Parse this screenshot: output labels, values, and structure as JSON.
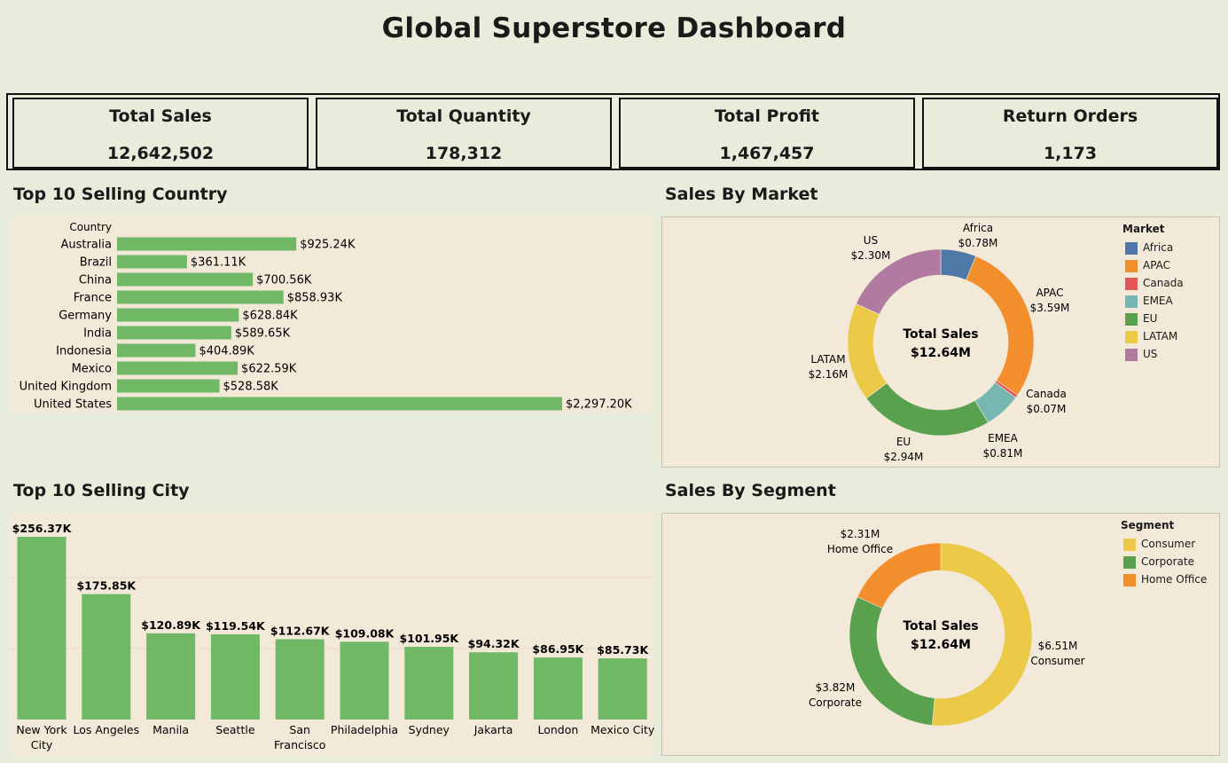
{
  "dashboard": {
    "title": "Global Superstore Dashboard"
  },
  "kpis": [
    {
      "label": "Total Sales",
      "value": "12,642,502"
    },
    {
      "label": "Total Quantity",
      "value": "178,312"
    },
    {
      "label": "Total Profit",
      "value": "1,467,457"
    },
    {
      "label": "Return Orders",
      "value": "1,173"
    }
  ],
  "sections": {
    "country": "Top 10 Selling Country",
    "market": "Sales By Market",
    "city": "Top 10 Selling City",
    "segment": "Sales By Segment"
  },
  "chart_data": [
    {
      "id": "country",
      "type": "bar",
      "orientation": "horizontal",
      "title": "Top 10 Selling Country",
      "axis_header": "Country",
      "color": "#70b865",
      "categories": [
        "Australia",
        "Brazil",
        "China",
        "France",
        "Germany",
        "India",
        "Indonesia",
        "Mexico",
        "United Kingdom",
        "United States"
      ],
      "values": [
        925.24,
        361.11,
        700.56,
        858.93,
        628.84,
        589.65,
        404.89,
        622.59,
        528.58,
        2297.2
      ],
      "labels": [
        "$925.24K",
        "$361.11K",
        "$700.56K",
        "$858.93K",
        "$628.84K",
        "$589.65K",
        "$404.89K",
        "$622.59K",
        "$528.58K",
        "$2,297.20K"
      ],
      "unit": "K"
    },
    {
      "id": "market",
      "type": "pie",
      "donut": true,
      "title": "Sales By Market",
      "center_label": "Total Sales",
      "center_value": "$12.64M",
      "legend_title": "Market",
      "legend_position": "top-right",
      "slices": [
        {
          "name": "Africa",
          "value": 0.78,
          "label": "$0.78M",
          "color": "#4e79a7"
        },
        {
          "name": "APAC",
          "value": 3.59,
          "label": "$3.59M",
          "color": "#f28e2b"
        },
        {
          "name": "Canada",
          "value": 0.07,
          "label": "$0.07M",
          "color": "#e15759"
        },
        {
          "name": "EMEA",
          "value": 0.81,
          "label": "$0.81M",
          "color": "#76b7b2"
        },
        {
          "name": "EU",
          "value": 2.94,
          "label": "$2.94M",
          "color": "#59a14f"
        },
        {
          "name": "LATAM",
          "value": 2.16,
          "label": "$2.16M",
          "color": "#edc948"
        },
        {
          "name": "US",
          "value": 2.3,
          "label": "$2.30M",
          "color": "#b07aa1"
        }
      ]
    },
    {
      "id": "city",
      "type": "bar",
      "orientation": "vertical",
      "title": "Top 10 Selling City",
      "color": "#70b865",
      "categories": [
        "New York City",
        "Los Angeles",
        "Manila",
        "Seattle",
        "San Francisco",
        "Philadelphia",
        "Sydney",
        "Jakarta",
        "London",
        "Mexico City"
      ],
      "category_lines": [
        [
          "New York",
          "City"
        ],
        [
          "Los Angeles"
        ],
        [
          "Manila"
        ],
        [
          "Seattle"
        ],
        [
          "San",
          "Francisco"
        ],
        [
          "Philadelphia"
        ],
        [
          "Sydney"
        ],
        [
          "Jakarta"
        ],
        [
          "London"
        ],
        [
          "Mexico City"
        ]
      ],
      "values": [
        256.37,
        175.85,
        120.89,
        119.54,
        112.67,
        109.08,
        101.95,
        94.32,
        86.95,
        85.73
      ],
      "labels": [
        "$256.37K",
        "$175.85K",
        "$120.89K",
        "$119.54K",
        "$112.67K",
        "$109.08K",
        "$101.95K",
        "$94.32K",
        "$86.95K",
        "$85.73K"
      ],
      "unit": "K",
      "grid": true
    },
    {
      "id": "segment",
      "type": "pie",
      "donut": true,
      "title": "Sales By Segment",
      "center_label": "Total Sales",
      "center_value": "$12.64M",
      "legend_title": "Segment",
      "legend_position": "top-right",
      "slices": [
        {
          "name": "Consumer",
          "value": 6.51,
          "label": "$6.51M",
          "color": "#edc948"
        },
        {
          "name": "Corporate",
          "value": 3.82,
          "label": "$3.82M",
          "color": "#59a14f"
        },
        {
          "name": "Home Office",
          "value": 2.31,
          "label": "$2.31M",
          "color": "#f28e2b"
        }
      ]
    }
  ]
}
